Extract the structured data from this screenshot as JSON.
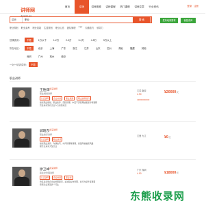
{
  "header": {
    "logo_main": "讲师网",
    "logo_sub": "Jiangshi.org",
    "nav": [
      "首页",
      "讲师",
      "讲师视频",
      "讲师课程",
      "热门课程",
      "讲师文章",
      "行业资讯"
    ],
    "nav_active_index": 1,
    "links": [
      "登录",
      "注册"
    ]
  },
  "search": {
    "select_value": "讲师",
    "query": "职业",
    "button_label": "搜 索",
    "green_buttons": [
      "发布培训需求",
      "我是讲师"
    ]
  },
  "hotwords": [
    "职业规划",
    "职业素养",
    "职业技能",
    "生涯规划",
    "职业心态",
    "团队管理",
    "TTT",
    "沟通技巧",
    "领导力"
  ],
  "filter": {
    "rows": [
      {
        "label": "授课费用：",
        "options": [
          "不限",
          "1万以下",
          "1-2万",
          "2-3万",
          "3-4万",
          "4-5万",
          "5万以上"
        ],
        "active": 0
      },
      {
        "label": "所在地区：",
        "options": [
          "不限",
          "北京",
          "上海",
          "广东",
          "浙江",
          "江苏",
          "山东",
          "四川",
          "湖北",
          "福建",
          "其他"
        ],
        "active": 0
      },
      {
        "label": "",
        "options": [
          "深圳",
          "广州",
          "杭州",
          "南京"
        ],
        "active": -1
      },
      {
        "label": "一对一培训讲师：",
        "options": [
          "不限"
        ],
        "active": 0
      }
    ]
  },
  "section_title": "职业讲师",
  "lecturers": [
    {
      "name": "王胜辉",
      "badge": "资深讲师",
      "title": "职业规划讲师",
      "tags": [
        "认证讲师",
        "企业内训",
        "职业规划",
        "职业素养提升"
      ],
      "desc_lines": [
        "擅长职业规划、职业素养、团队管理、中层干部管理技能提升等课程",
        "曾任多家知名企业人力资源总监"
      ],
      "location": "江苏 南京",
      "rating": "4.90",
      "phone": "13800000000",
      "price": "¥20000",
      "price_unit": "/天"
    },
    {
      "name": "郭晓东",
      "badge": "资深讲师",
      "title": "职业素养讲师",
      "tags": [
        "认证讲师",
        "职业素养"
      ],
      "desc_lines": [
        "擅长职业素养、沟通技巧、时间管理等课程，授课风格幽默风趣",
        "服务过多家大型企业"
      ],
      "location": "江西 九江",
      "rating": "",
      "phone": "",
      "price": "¥0",
      "price_unit": "/天"
    },
    {
      "name": "廖卫峰",
      "badge": "资深讲师",
      "title": "职业化管理讲师",
      "tags": [
        "认证讲师",
        "企业内训",
        "职业化"
      ],
      "desc_lines": [
        "曾任多家知名企业管理顾问，主讲职业化管理、执行力提升等课程",
        "授课企业涵盖多个行业"
      ],
      "location": "广东 深圳",
      "rating": "4.90",
      "phone": "",
      "price": "¥18000",
      "price_unit": "/天"
    }
  ],
  "watermark": "东熊收录网"
}
